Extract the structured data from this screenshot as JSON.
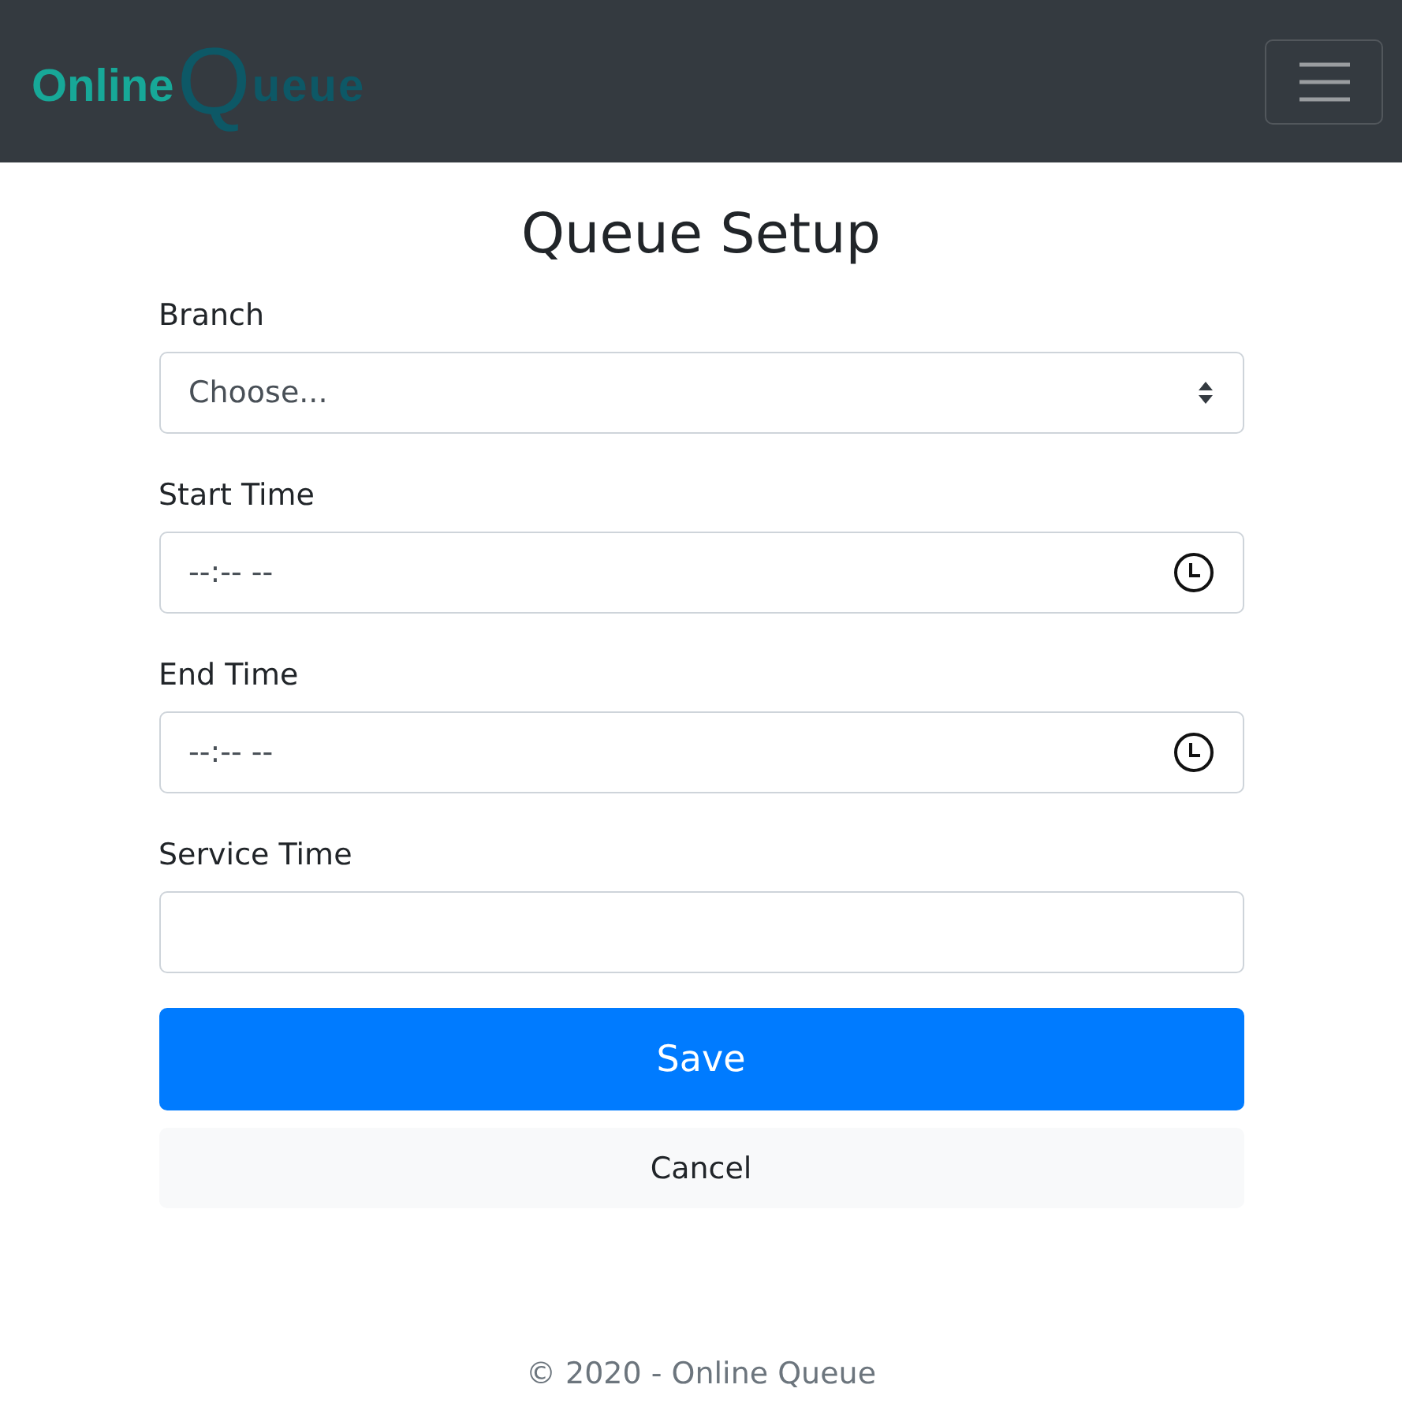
{
  "navbar": {
    "brand": {
      "first": "Online",
      "second": "Queue"
    }
  },
  "title": "Queue Setup",
  "fields": [
    {
      "label": "Branch",
      "kind": "select",
      "value": "Choose..."
    },
    {
      "label": "Start Time",
      "kind": "time",
      "value": "--:-- --"
    },
    {
      "label": "End Time",
      "kind": "time",
      "value": "--:-- --"
    },
    {
      "label": "Service Time",
      "kind": "text"
    }
  ],
  "buttons": [
    {
      "label": "Save",
      "kind": "primary"
    },
    {
      "label": "Cancel",
      "kind": "light"
    }
  ],
  "footer": "© 2020 - Online Queue"
}
